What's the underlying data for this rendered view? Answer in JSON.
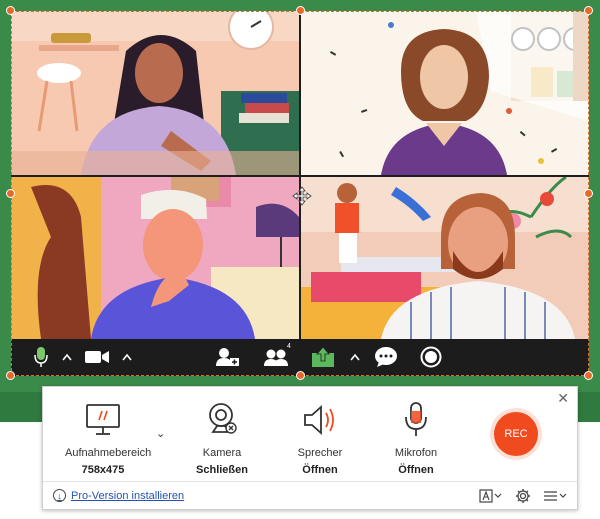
{
  "panel": {
    "tools": [
      {
        "label": "Aufnahmebereich",
        "value": "758x475",
        "icon": "monitor-icon"
      },
      {
        "label": "Kamera",
        "value": "Schließen",
        "icon": "webcam-icon"
      },
      {
        "label": "Sprecher",
        "value": "Öffnen",
        "icon": "speaker-icon"
      },
      {
        "label": "Mikrofon",
        "value": "Öffnen",
        "icon": "microphone-icon"
      }
    ],
    "rec_label": "REC",
    "pro_link": "Pro-Version installieren",
    "close_glyph": "✕",
    "caret_glyph": "⌄"
  },
  "meeting_bar": {
    "participants_count": "4"
  },
  "colors": {
    "accent": "#f04a1f",
    "selection": "#e06b2c",
    "desktop": "#3a8a4a"
  }
}
